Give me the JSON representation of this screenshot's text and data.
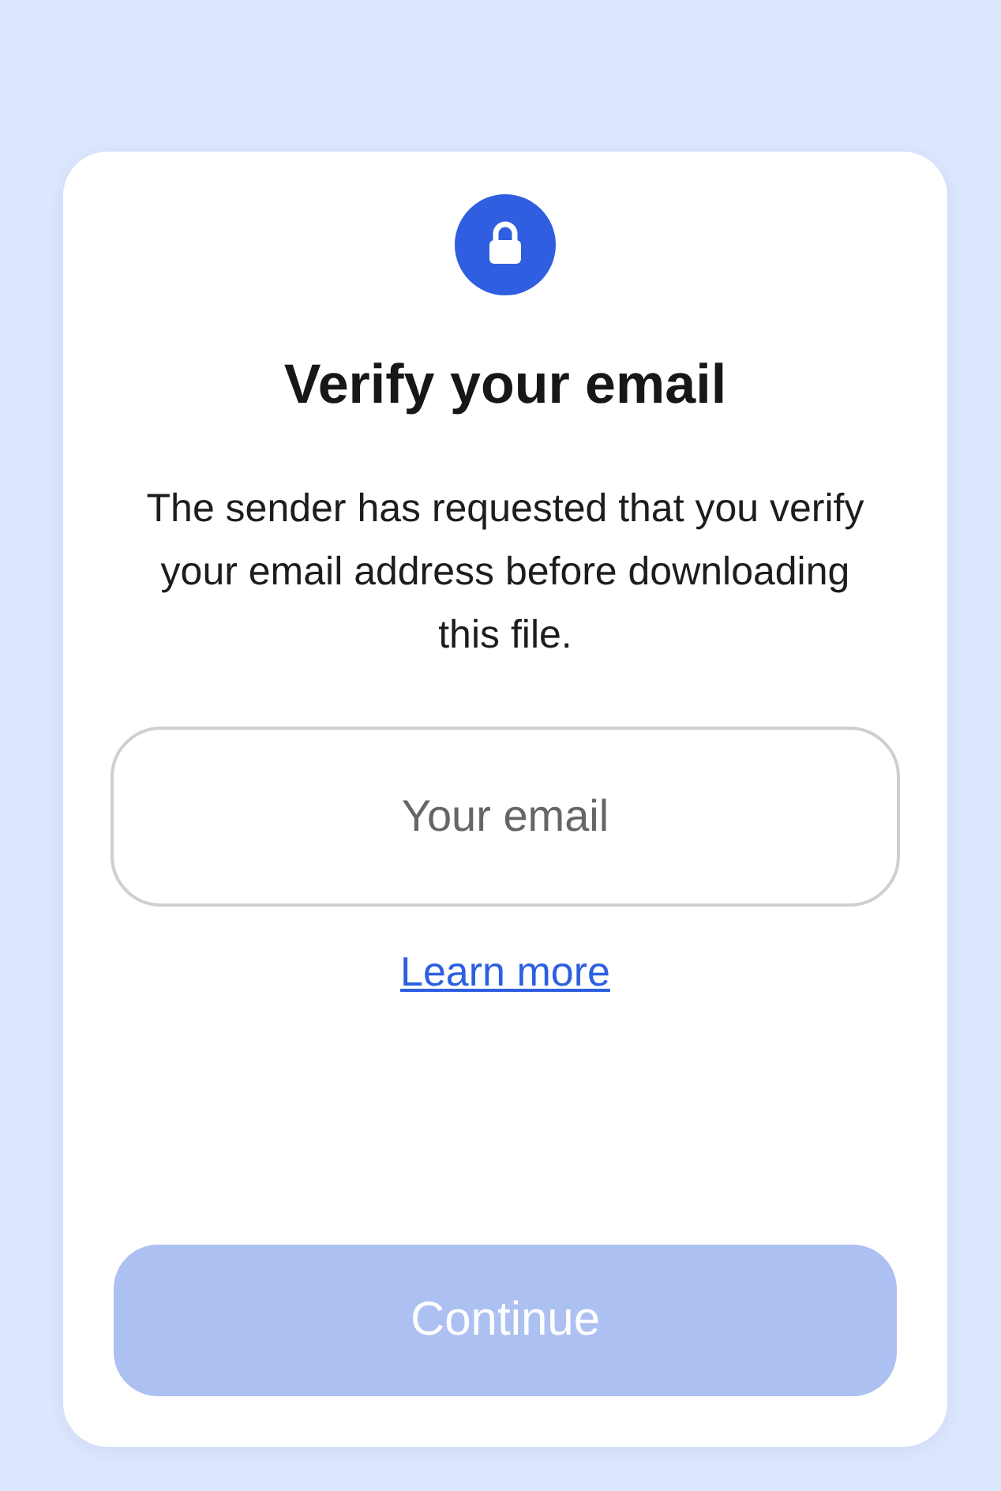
{
  "dialog": {
    "title": "Verify your email",
    "description": "The sender has requested that you verify your email address before downloading this file.",
    "email_field": {
      "placeholder": "Your email"
    },
    "learn_more_link": "Learn more",
    "continue_button": {
      "label": "Continue",
      "disabled": true
    }
  }
}
